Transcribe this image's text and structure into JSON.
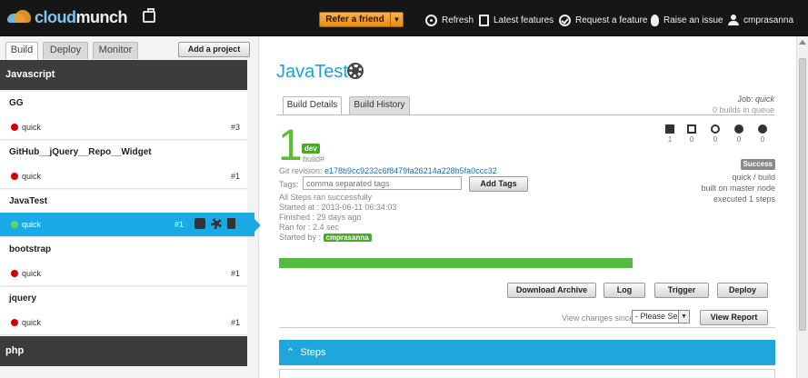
{
  "header": {
    "logo_prefix": "cloud",
    "logo_suffix": "munch",
    "refer_label": "Refer a friend",
    "nav": {
      "refresh": "Refresh",
      "latest_features": "Latest features",
      "request_feature": "Request a feature",
      "raise_issue": "Raise an issue",
      "user": "cmprasanna"
    }
  },
  "sidebar": {
    "tabs": [
      "Build",
      "Deploy",
      "Monitor"
    ],
    "add_project": "Add a project",
    "groups": {
      "javascript": "Javascript",
      "php": "php"
    },
    "projects": [
      {
        "name": "GG",
        "branch": "quick",
        "num": "#3"
      },
      {
        "name": "GitHub__jQuery__Repo__Widget",
        "branch": "quick",
        "num": "#1"
      },
      {
        "name": "JavaTest",
        "branch": "quick",
        "num": "#1"
      },
      {
        "name": "bootstrap",
        "branch": "quick",
        "num": "#1"
      },
      {
        "name": "jquery",
        "branch": "quick",
        "num": "#1"
      }
    ]
  },
  "main": {
    "title": "JavaTest",
    "tabs": [
      "Build Details",
      "Build History"
    ],
    "job_label": "Job:",
    "job_name": "quick",
    "builds_in_queue": "0 builds in queue",
    "stats": [
      "1",
      "0",
      "0",
      "0",
      "0"
    ],
    "build": {
      "number": "1",
      "branch_badge": "dev",
      "hash_label": "build#",
      "git_revision_label": "Git revision:",
      "git_revision": "e178b9cc9232c6f8479fa26214a228b5fa0ccc32",
      "tags_label": "Tags:",
      "tags_placeholder": "comma separated tags",
      "add_tags": "Add Tags",
      "steps_status": "All Steps ran successfully",
      "started_at": "Started at : 2013-06-11 06:34:03",
      "finished": "Finished : 29 days ago",
      "ran_for": "Ran for : 2.4 sec",
      "started_by_label": "Started by :",
      "started_by": "cmprasanna",
      "progress": 1.0
    },
    "status": {
      "badge": "Success",
      "line1": "quick / build",
      "line2": "built on master node",
      "line3": "executed 1 steps"
    },
    "actions": [
      "Download Archive",
      "Log",
      "Trigger",
      "Deploy"
    ],
    "view_changes_label": "View changes since:",
    "view_changes_value": "- Please Sel",
    "view_report": "View Report",
    "steps_label": "Steps"
  },
  "colors": {
    "accent": "#1ea6dd",
    "success": "#55bb3f",
    "failed_dot": "#d40000"
  }
}
